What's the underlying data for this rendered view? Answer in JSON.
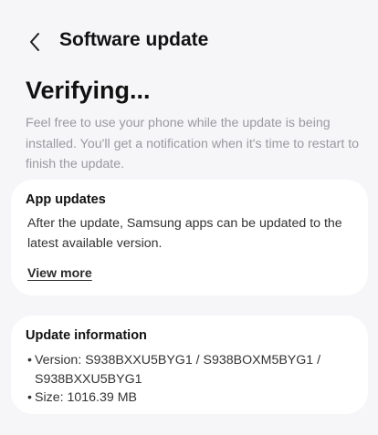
{
  "header": {
    "title": "Software update",
    "back_icon": "chevron-left-icon"
  },
  "status": {
    "title": "Verifying...",
    "description": "Feel free to use your phone while the update is being installed. You'll get a notification when it's time to restart to finish the update."
  },
  "app_updates": {
    "heading": "App updates",
    "text": "After the update, Samsung apps can be updated to the latest available version.",
    "link_label": "View more"
  },
  "update_info": {
    "heading": "Update information",
    "bullet": "•",
    "items": [
      "Version: S938BXXU5BYG1 / S938BOXM5BYG1 / S938BXXU5BYG1",
      "Size: 1016.39 MB"
    ]
  },
  "colors": {
    "background": "#f6f6f8",
    "card": "#ffffff",
    "muted_text": "#9a9a9f"
  }
}
